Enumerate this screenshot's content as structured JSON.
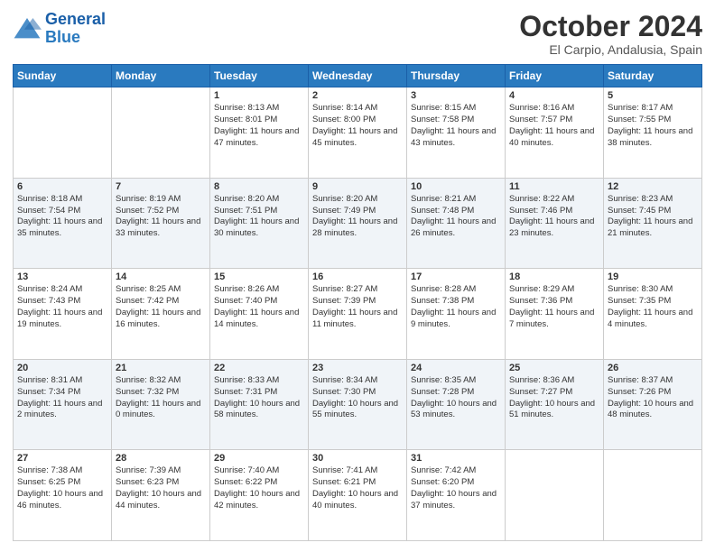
{
  "header": {
    "logo_line1": "General",
    "logo_line2": "Blue",
    "title": "October 2024",
    "subtitle": "El Carpio, Andalusia, Spain"
  },
  "days_of_week": [
    "Sunday",
    "Monday",
    "Tuesday",
    "Wednesday",
    "Thursday",
    "Friday",
    "Saturday"
  ],
  "weeks": [
    [
      {
        "day": "",
        "info": ""
      },
      {
        "day": "",
        "info": ""
      },
      {
        "day": "1",
        "info": "Sunrise: 8:13 AM\nSunset: 8:01 PM\nDaylight: 11 hours and 47 minutes."
      },
      {
        "day": "2",
        "info": "Sunrise: 8:14 AM\nSunset: 8:00 PM\nDaylight: 11 hours and 45 minutes."
      },
      {
        "day": "3",
        "info": "Sunrise: 8:15 AM\nSunset: 7:58 PM\nDaylight: 11 hours and 43 minutes."
      },
      {
        "day": "4",
        "info": "Sunrise: 8:16 AM\nSunset: 7:57 PM\nDaylight: 11 hours and 40 minutes."
      },
      {
        "day": "5",
        "info": "Sunrise: 8:17 AM\nSunset: 7:55 PM\nDaylight: 11 hours and 38 minutes."
      }
    ],
    [
      {
        "day": "6",
        "info": "Sunrise: 8:18 AM\nSunset: 7:54 PM\nDaylight: 11 hours and 35 minutes."
      },
      {
        "day": "7",
        "info": "Sunrise: 8:19 AM\nSunset: 7:52 PM\nDaylight: 11 hours and 33 minutes."
      },
      {
        "day": "8",
        "info": "Sunrise: 8:20 AM\nSunset: 7:51 PM\nDaylight: 11 hours and 30 minutes."
      },
      {
        "day": "9",
        "info": "Sunrise: 8:20 AM\nSunset: 7:49 PM\nDaylight: 11 hours and 28 minutes."
      },
      {
        "day": "10",
        "info": "Sunrise: 8:21 AM\nSunset: 7:48 PM\nDaylight: 11 hours and 26 minutes."
      },
      {
        "day": "11",
        "info": "Sunrise: 8:22 AM\nSunset: 7:46 PM\nDaylight: 11 hours and 23 minutes."
      },
      {
        "day": "12",
        "info": "Sunrise: 8:23 AM\nSunset: 7:45 PM\nDaylight: 11 hours and 21 minutes."
      }
    ],
    [
      {
        "day": "13",
        "info": "Sunrise: 8:24 AM\nSunset: 7:43 PM\nDaylight: 11 hours and 19 minutes."
      },
      {
        "day": "14",
        "info": "Sunrise: 8:25 AM\nSunset: 7:42 PM\nDaylight: 11 hours and 16 minutes."
      },
      {
        "day": "15",
        "info": "Sunrise: 8:26 AM\nSunset: 7:40 PM\nDaylight: 11 hours and 14 minutes."
      },
      {
        "day": "16",
        "info": "Sunrise: 8:27 AM\nSunset: 7:39 PM\nDaylight: 11 hours and 11 minutes."
      },
      {
        "day": "17",
        "info": "Sunrise: 8:28 AM\nSunset: 7:38 PM\nDaylight: 11 hours and 9 minutes."
      },
      {
        "day": "18",
        "info": "Sunrise: 8:29 AM\nSunset: 7:36 PM\nDaylight: 11 hours and 7 minutes."
      },
      {
        "day": "19",
        "info": "Sunrise: 8:30 AM\nSunset: 7:35 PM\nDaylight: 11 hours and 4 minutes."
      }
    ],
    [
      {
        "day": "20",
        "info": "Sunrise: 8:31 AM\nSunset: 7:34 PM\nDaylight: 11 hours and 2 minutes."
      },
      {
        "day": "21",
        "info": "Sunrise: 8:32 AM\nSunset: 7:32 PM\nDaylight: 11 hours and 0 minutes."
      },
      {
        "day": "22",
        "info": "Sunrise: 8:33 AM\nSunset: 7:31 PM\nDaylight: 10 hours and 58 minutes."
      },
      {
        "day": "23",
        "info": "Sunrise: 8:34 AM\nSunset: 7:30 PM\nDaylight: 10 hours and 55 minutes."
      },
      {
        "day": "24",
        "info": "Sunrise: 8:35 AM\nSunset: 7:28 PM\nDaylight: 10 hours and 53 minutes."
      },
      {
        "day": "25",
        "info": "Sunrise: 8:36 AM\nSunset: 7:27 PM\nDaylight: 10 hours and 51 minutes."
      },
      {
        "day": "26",
        "info": "Sunrise: 8:37 AM\nSunset: 7:26 PM\nDaylight: 10 hours and 48 minutes."
      }
    ],
    [
      {
        "day": "27",
        "info": "Sunrise: 7:38 AM\nSunset: 6:25 PM\nDaylight: 10 hours and 46 minutes."
      },
      {
        "day": "28",
        "info": "Sunrise: 7:39 AM\nSunset: 6:23 PM\nDaylight: 10 hours and 44 minutes."
      },
      {
        "day": "29",
        "info": "Sunrise: 7:40 AM\nSunset: 6:22 PM\nDaylight: 10 hours and 42 minutes."
      },
      {
        "day": "30",
        "info": "Sunrise: 7:41 AM\nSunset: 6:21 PM\nDaylight: 10 hours and 40 minutes."
      },
      {
        "day": "31",
        "info": "Sunrise: 7:42 AM\nSunset: 6:20 PM\nDaylight: 10 hours and 37 minutes."
      },
      {
        "day": "",
        "info": ""
      },
      {
        "day": "",
        "info": ""
      }
    ]
  ]
}
